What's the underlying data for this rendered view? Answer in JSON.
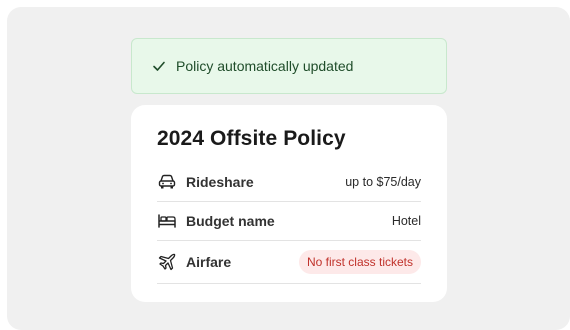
{
  "toast": {
    "message": "Policy automatically updated",
    "icon": "check-icon",
    "color": "#1f4d2a",
    "background": "#e8f8ea"
  },
  "policy": {
    "title": "2024 Offsite Policy",
    "rows": [
      {
        "label": "Rideshare",
        "value": "up to $75/day",
        "icon": "car-icon"
      },
      {
        "label": "Budget name",
        "value": "Hotel",
        "icon": "bed-icon"
      },
      {
        "label": "Airfare",
        "value": "No first class tickets",
        "icon": "airplane-icon",
        "badge_color": "#c0322b"
      }
    ]
  }
}
